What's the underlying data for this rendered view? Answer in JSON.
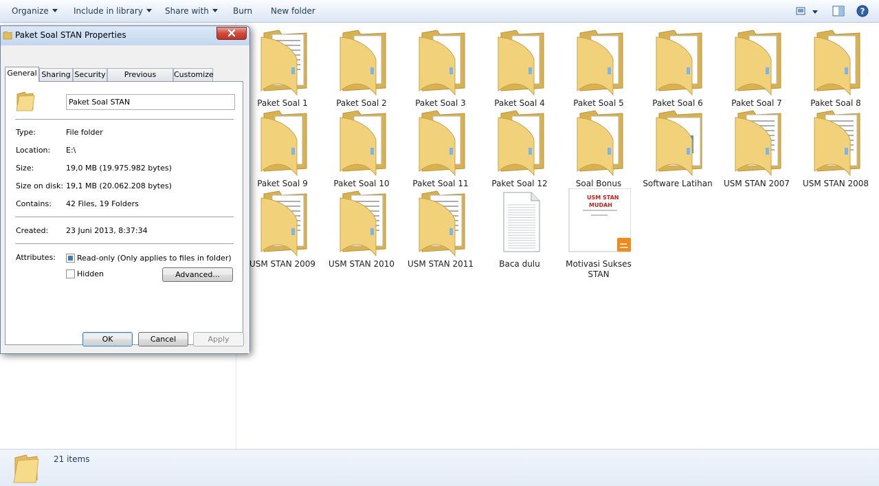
{
  "toolbar": {
    "organize": "Organize",
    "include_in_library": "Include in library",
    "share_with": "Share with",
    "burn": "Burn",
    "new_folder": "New folder",
    "right_icons": [
      "change-view-icon",
      "preview-pane-icon",
      "help-icon"
    ]
  },
  "items": [
    {
      "label": "Paket Soal 1",
      "kind": "folder-doc"
    },
    {
      "label": "Paket Soal 2",
      "kind": "folder"
    },
    {
      "label": "Paket Soal 3",
      "kind": "folder"
    },
    {
      "label": "Paket Soal 4",
      "kind": "folder"
    },
    {
      "label": "Paket Soal 5",
      "kind": "folder"
    },
    {
      "label": "Paket Soal 6",
      "kind": "folder"
    },
    {
      "label": "Paket Soal 7",
      "kind": "folder"
    },
    {
      "label": "Paket Soal 8",
      "kind": "folder"
    },
    {
      "label": "Paket Soal 9",
      "kind": "folder"
    },
    {
      "label": "Paket Soal 10",
      "kind": "folder"
    },
    {
      "label": "Paket Soal 11",
      "kind": "folder"
    },
    {
      "label": "Paket Soal 12",
      "kind": "folder"
    },
    {
      "label": "Soal Bonus",
      "kind": "folder"
    },
    {
      "label": "Software Latihan",
      "kind": "folder-app"
    },
    {
      "label": "USM STAN 2007",
      "kind": "folder-doc"
    },
    {
      "label": "USM STAN 2008",
      "kind": "folder-doc"
    },
    {
      "label": "USM STAN 2009",
      "kind": "folder-doc"
    },
    {
      "label": "USM STAN 2010",
      "kind": "folder-doc"
    },
    {
      "label": "USM STAN 2011",
      "kind": "folder-doc"
    },
    {
      "label": "Baca dulu",
      "kind": "textfile"
    },
    {
      "label": "Motivasi Sukses STAN",
      "kind": "pdf"
    }
  ],
  "pdf_cover": {
    "line1": "USM STAN",
    "line2": "MUDAH"
  },
  "status": {
    "count": "21 items"
  },
  "dialog": {
    "title": "Paket Soal STAN Properties",
    "tabs": [
      "General",
      "Sharing",
      "Security",
      "Previous Versions",
      "Customize"
    ],
    "folder_name": "Paket Soal STAN",
    "type_label": "Type:",
    "type_value": "File folder",
    "location_label": "Location:",
    "location_value": "E:\\",
    "size_label": "Size:",
    "size_value": "19,0 MB (19.975.982 bytes)",
    "size_on_disk_label": "Size on disk:",
    "size_on_disk_value": "19,1 MB (20.062.208 bytes)",
    "contains_label": "Contains:",
    "contains_value": "42 Files, 19 Folders",
    "created_label": "Created:",
    "created_value": "23 Juni 2013, 8:37:34",
    "attributes_label": "Attributes:",
    "readonly_label": "Read-only (Only applies to files in folder)",
    "hidden_label": "Hidden",
    "advanced_button": "Advanced...",
    "ok_button": "OK",
    "cancel_button": "Cancel",
    "apply_button": "Apply"
  },
  "colors": {
    "folder": "#f1d27a",
    "folder_dark": "#d9b24e",
    "accent": "#3c7fb1",
    "pdf_badge": "#f08a1c"
  }
}
